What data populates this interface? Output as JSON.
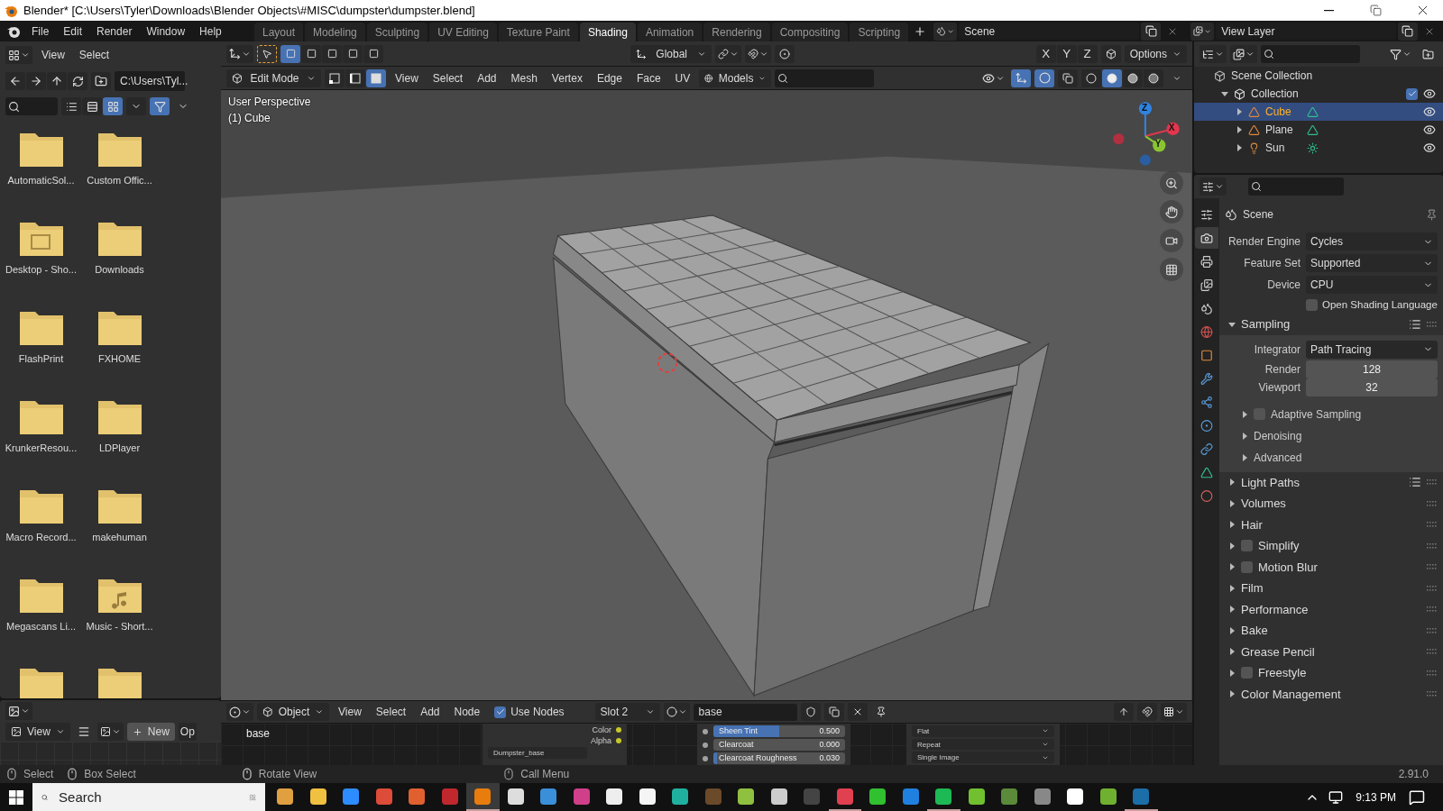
{
  "window": {
    "title": "Blender* [C:\\Users\\Tyler\\Downloads\\Blender Objects\\#MISC\\dumpster\\dumpster.blend]"
  },
  "menu": [
    "File",
    "Edit",
    "Render",
    "Window",
    "Help"
  ],
  "workspaces": [
    {
      "label": "Layout",
      "selected": false
    },
    {
      "label": "Modeling",
      "selected": false
    },
    {
      "label": "Sculpting",
      "selected": false
    },
    {
      "label": "UV Editing",
      "selected": false
    },
    {
      "label": "Texture Paint",
      "selected": false
    },
    {
      "label": "Shading",
      "selected": true
    },
    {
      "label": "Animation",
      "selected": false
    },
    {
      "label": "Rendering",
      "selected": false
    },
    {
      "label": "Compositing",
      "selected": false
    },
    {
      "label": "Scripting",
      "selected": false
    }
  ],
  "scene": "Scene",
  "view_layer": "View Layer",
  "file_browser": {
    "menu": [
      "View",
      "Select"
    ],
    "path": "C:\\Users\\Tyl...",
    "display_modes": [
      {
        "selected": false
      },
      {
        "selected": false
      },
      {
        "selected": true
      }
    ],
    "items": [
      {
        "label": "AutomaticSol...",
        "kind": "folder"
      },
      {
        "label": "Custom Offic...",
        "kind": "folder"
      },
      {
        "label": "Desktop - Sho...",
        "kind": "shortcut"
      },
      {
        "label": "Downloads",
        "kind": "folder"
      },
      {
        "label": "FlashPrint",
        "kind": "folder"
      },
      {
        "label": "FXHOME",
        "kind": "folder"
      },
      {
        "label": "KrunkerResou...",
        "kind": "folder"
      },
      {
        "label": "LDPlayer",
        "kind": "folder"
      },
      {
        "label": "Macro Record...",
        "kind": "folder"
      },
      {
        "label": "makehuman",
        "kind": "folder"
      },
      {
        "label": "Megascans Li...",
        "kind": "folder"
      },
      {
        "label": "Music - Short...",
        "kind": "music"
      },
      {
        "kind": "folder"
      },
      {
        "kind": "folder"
      }
    ]
  },
  "image_editor": {
    "view": "View",
    "new": "New",
    "open": "Op"
  },
  "viewport": {
    "transform": "Global",
    "options": "Options",
    "axes": [
      "X",
      "Y",
      "Z"
    ],
    "mode": "Edit Mode",
    "select_modes": [
      {
        "kind": "vertex",
        "selected": false
      },
      {
        "kind": "edge",
        "selected": false
      },
      {
        "kind": "face",
        "selected": true
      }
    ],
    "menus": [
      "View",
      "Select",
      "Add",
      "Mesh",
      "Vertex",
      "Edge",
      "Face",
      "UV"
    ],
    "collection": "Models",
    "shading": [
      {
        "kind": "wireframe",
        "selected": false
      },
      {
        "kind": "solid",
        "selected": true
      },
      {
        "kind": "material",
        "selected": false
      },
      {
        "kind": "rendered",
        "selected": false
      }
    ],
    "perspective": "User Perspective",
    "object": "(1) Cube",
    "gizmo": [
      {
        "label": "Z",
        "color": "#2f83e2"
      },
      {
        "label": "X",
        "color": "#e2364d"
      },
      {
        "label": "Y",
        "color": "#8ac531"
      }
    ]
  },
  "node_editor": {
    "object_mode": "Object",
    "menus": [
      "View",
      "Select",
      "Add",
      "Node"
    ],
    "use_nodes": {
      "label": "Use Nodes",
      "checked": true
    },
    "slot": "Slot 2",
    "material": "base",
    "frame_label": "base",
    "outputs": [
      "Color",
      "Alpha"
    ],
    "image": "Dumpster_base",
    "inputs": [
      {
        "label": "Sheen Tint",
        "value": "0.500",
        "level": 0.5
      },
      {
        "label": "Clearcoat",
        "value": "0.000",
        "level": 0
      },
      {
        "label": "Clearcoat Roughness",
        "value": "0.030",
        "level": 0.03
      }
    ],
    "dropdowns": [
      "Flat",
      "Repeat",
      "Single Image"
    ]
  },
  "outliner": {
    "root": "Scene Collection",
    "collection": {
      "label": "Collection",
      "checked": true,
      "children": [
        {
          "label": "Cube",
          "kind": "mesh",
          "selected": true
        },
        {
          "label": "Plane",
          "kind": "mesh",
          "selected": false
        },
        {
          "label": "Sun",
          "kind": "light",
          "selected": false
        }
      ]
    }
  },
  "properties": {
    "tabs": [
      {
        "kind": "tool",
        "selected": false
      },
      {
        "kind": "render",
        "selected": true
      },
      {
        "kind": "output",
        "selected": false
      },
      {
        "kind": "view_layer",
        "selected": false
      },
      {
        "kind": "scene",
        "selected": false
      },
      {
        "kind": "world",
        "selected": false
      },
      {
        "kind": "object",
        "selected": false
      },
      {
        "kind": "modifiers",
        "selected": false
      },
      {
        "kind": "particles",
        "selected": false
      },
      {
        "kind": "physics",
        "selected": false
      },
      {
        "kind": "constraints",
        "selected": false
      },
      {
        "kind": "data",
        "selected": false
      },
      {
        "kind": "material",
        "selected": false
      }
    ],
    "context": "Scene",
    "fields": [
      {
        "label": "Render Engine",
        "value": "Cycles"
      },
      {
        "label": "Feature Set",
        "value": "Supported"
      },
      {
        "label": "Device",
        "value": "CPU"
      }
    ],
    "osl": {
      "label": "Open Shading Language",
      "checked": false
    },
    "sampling": {
      "label": "Sampling",
      "expanded": true,
      "integrator": {
        "label": "Integrator",
        "value": "Path Tracing"
      },
      "numbers": [
        {
          "label": "Render",
          "value": "128"
        },
        {
          "label": "Viewport",
          "value": "32"
        }
      ],
      "subpanels": [
        {
          "label": "Adaptive Sampling",
          "kind": "checkbox",
          "checked": false
        },
        {
          "label": "Denoising",
          "kind": "plain"
        },
        {
          "label": "Advanced",
          "kind": "plain"
        }
      ]
    },
    "panels": [
      {
        "label": "Light Paths",
        "kind": "presets"
      },
      {
        "label": "Volumes",
        "kind": "plain"
      },
      {
        "label": "Hair",
        "kind": "plain"
      },
      {
        "label": "Simplify",
        "kind": "checkbox",
        "checked": false
      },
      {
        "label": "Motion Blur",
        "kind": "checkbox",
        "checked": false
      },
      {
        "label": "Film",
        "kind": "plain"
      },
      {
        "label": "Performance",
        "kind": "plain"
      },
      {
        "label": "Bake",
        "kind": "plain"
      },
      {
        "label": "Grease Pencil",
        "kind": "plain"
      },
      {
        "label": "Freestyle",
        "kind": "checkbox",
        "checked": false
      },
      {
        "label": "Color Management",
        "kind": "plain"
      }
    ]
  },
  "status_bar": {
    "hints": [
      {
        "kind": "left",
        "label": "Select"
      },
      {
        "kind": "drag",
        "label": "Box Select"
      },
      {
        "kind": "middle",
        "label": "Rotate View"
      },
      {
        "kind": "right",
        "label": "Call Menu"
      }
    ],
    "version": "2.91.0"
  },
  "taskbar": {
    "search": {
      "placeholder": "Search"
    },
    "apps": [
      {
        "color": "#e0a040",
        "running": false,
        "selected": false
      },
      {
        "color": "#f0c040",
        "running": false,
        "selected": false
      },
      {
        "color": "#2d8cff",
        "running": false,
        "selected": false
      },
      {
        "color": "#dd4b39",
        "running": false,
        "selected": false
      },
      {
        "color": "#e06030",
        "running": false,
        "selected": false
      },
      {
        "color": "#c0282e",
        "running": false,
        "selected": false
      },
      {
        "color": "#e87d0d",
        "running": true,
        "selected": true
      },
      {
        "color": "#dddddd",
        "running": false,
        "selected": false
      },
      {
        "color": "#3a8fd9",
        "running": false,
        "selected": false
      },
      {
        "color": "#d0408a",
        "running": false,
        "selected": false
      },
      {
        "color": "#eeeeee",
        "running": false,
        "selected": false
      },
      {
        "color": "#f5f5f5",
        "running": false,
        "selected": false
      },
      {
        "color": "#20b0a0",
        "running": false,
        "selected": false
      },
      {
        "color": "#6b4a2a",
        "running": false,
        "selected": false
      },
      {
        "color": "#90c040",
        "running": false,
        "selected": false
      },
      {
        "color": "#cccccc",
        "running": false,
        "selected": false
      },
      {
        "color": "#444444",
        "running": false,
        "selected": false
      },
      {
        "color": "#e04050",
        "running": true,
        "selected": false
      },
      {
        "color": "#30c030",
        "running": false,
        "selected": false
      },
      {
        "color": "#2080e0",
        "running": false,
        "selected": false
      },
      {
        "color": "#1db954",
        "running": true,
        "selected": false
      },
      {
        "color": "#70c030",
        "running": false,
        "selected": false
      },
      {
        "color": "#5a8a3a",
        "running": false,
        "selected": false
      },
      {
        "color": "#888888",
        "running": false,
        "selected": false
      },
      {
        "color": "#ffffff",
        "running": false,
        "selected": false
      },
      {
        "color": "#70b030",
        "running": false,
        "selected": false
      },
      {
        "color": "#1b6ea8",
        "running": true,
        "selected": false
      }
    ],
    "clock": "9:13 PM"
  }
}
